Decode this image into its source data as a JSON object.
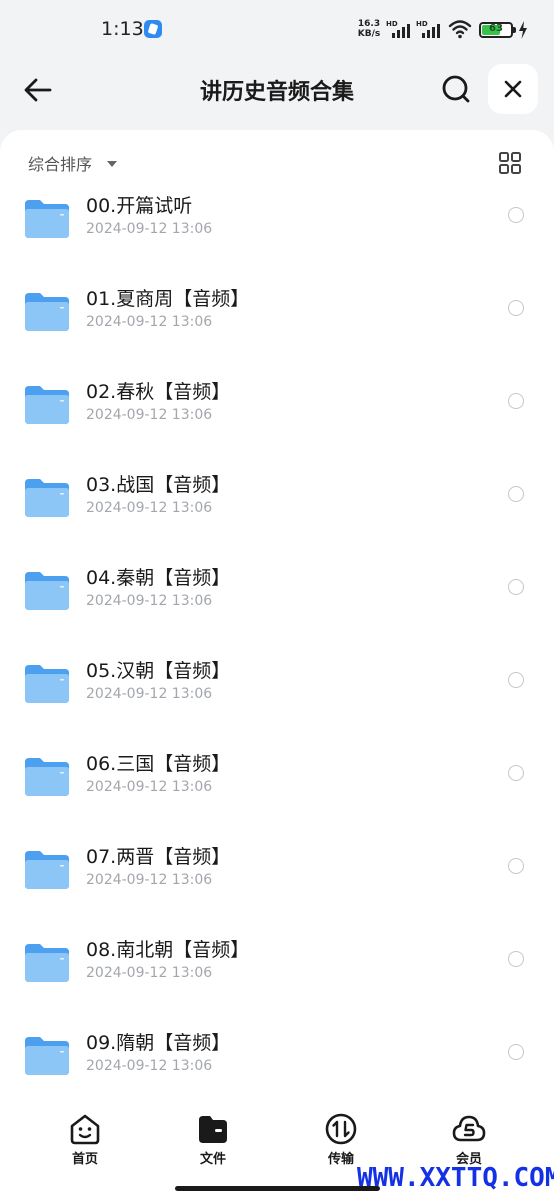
{
  "status_bar": {
    "time": "1:13",
    "net_speed_value": "16.3",
    "net_speed_unit": "KB/s",
    "signal_label": "HD",
    "battery_level": "63",
    "battery_fraction": 0.63
  },
  "header": {
    "title": "讲历史音频合集",
    "back_icon": "arrow-left-icon",
    "search_icon": "search-icon",
    "close_icon": "close-icon"
  },
  "toolbar": {
    "sort_label": "综合排序",
    "view_toggle_icon": "grid-view-icon"
  },
  "files": [
    {
      "name": "00.开篇试听",
      "date": "2024-09-12 13:06"
    },
    {
      "name": "01.夏商周【音频】",
      "date": "2024-09-12 13:06"
    },
    {
      "name": "02.春秋【音频】",
      "date": "2024-09-12 13:06"
    },
    {
      "name": "03.战国【音频】",
      "date": "2024-09-12 13:06"
    },
    {
      "name": "04.秦朝【音频】",
      "date": "2024-09-12 13:06"
    },
    {
      "name": "05.汉朝【音频】",
      "date": "2024-09-12 13:06"
    },
    {
      "name": "06.三国【音频】",
      "date": "2024-09-12 13:06"
    },
    {
      "name": "07.两晋【音频】",
      "date": "2024-09-12 13:06"
    },
    {
      "name": "08.南北朝【音频】",
      "date": "2024-09-12 13:06"
    },
    {
      "name": "09.隋朝【音频】",
      "date": "2024-09-12 13:06"
    }
  ],
  "bottom_nav": {
    "items": [
      {
        "label": "首页",
        "icon": "home-icon"
      },
      {
        "label": "文件",
        "icon": "file-icon"
      },
      {
        "label": "传输",
        "icon": "transfer-icon"
      },
      {
        "label": "会员",
        "icon": "vip-icon"
      }
    ]
  },
  "watermark": "WWW.XXTTQ.COM",
  "colors": {
    "background": "#f2f3f5",
    "folder_blue": "#7fbdf3",
    "watermark_blue": "#1531e6",
    "battery_green": "#39c24a"
  }
}
